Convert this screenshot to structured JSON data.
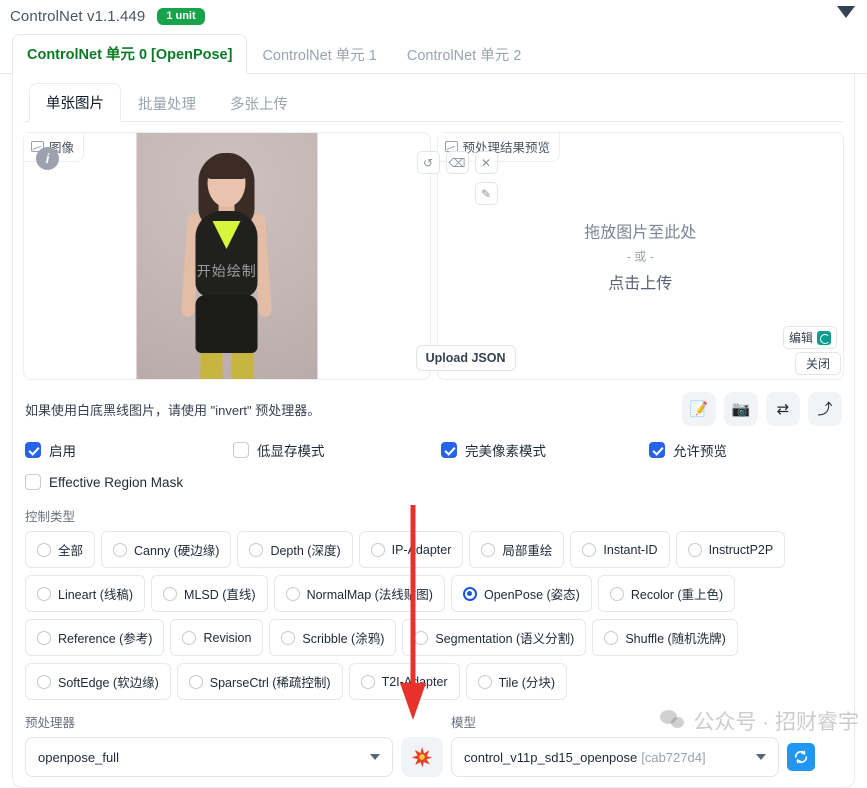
{
  "header": {
    "title": "ControlNet v1.1.449",
    "badge": "1 unit",
    "collapse_icon": "triangle-down-icon"
  },
  "outer_tabs": [
    {
      "label": "ControlNet 单元 0 [OpenPose]",
      "active": true
    },
    {
      "label": "ControlNet 单元 1",
      "active": false
    },
    {
      "label": "ControlNet 单元 2",
      "active": false
    }
  ],
  "inner_tabs": [
    {
      "label": "单张图片",
      "active": true
    },
    {
      "label": "批量处理",
      "active": false
    },
    {
      "label": "多张上传",
      "active": false
    }
  ],
  "image_panel": {
    "label": "图像",
    "info_badge": "i",
    "photo_watermark": "开始绘制",
    "tools": [
      {
        "name": "undo-icon",
        "glyph": "↺"
      },
      {
        "name": "eraser-icon",
        "glyph": "⌫"
      },
      {
        "name": "close-icon",
        "glyph": "✕"
      },
      {
        "name": "pen-icon",
        "glyph": "✎"
      }
    ],
    "upload_json": "Upload JSON"
  },
  "preview_panel": {
    "label": "预处理结果预览",
    "drop_line1": "拖放图片至此处",
    "drop_line2": "- 或 -",
    "drop_line3": "点击上传",
    "edit_button": "编辑",
    "close_button": "关闭"
  },
  "hint": {
    "text": "如果使用白底黑线图片，请使用 \"invert\" 预处理器。",
    "buttons": [
      {
        "name": "edit-note-icon",
        "glyph": "📝"
      },
      {
        "name": "camera-icon",
        "glyph": "📷"
      },
      {
        "name": "swap-icon",
        "glyph": "⇄"
      },
      {
        "name": "send-to-icon",
        "glyph": "⤴"
      }
    ]
  },
  "checkboxes_row1": [
    {
      "label": "启用",
      "checked": true
    },
    {
      "label": "低显存模式",
      "checked": false
    },
    {
      "label": "完美像素模式",
      "checked": true
    },
    {
      "label": "允许预览",
      "checked": true
    }
  ],
  "checkboxes_row2": [
    {
      "label": "Effective Region Mask",
      "checked": false
    }
  ],
  "control_type": {
    "label": "控制类型",
    "rows": [
      [
        {
          "label": "全部",
          "selected": false
        },
        {
          "label": "Canny (硬边缘)",
          "selected": false
        },
        {
          "label": "Depth (深度)",
          "selected": false
        },
        {
          "label": "IP-Adapter",
          "selected": false
        },
        {
          "label": "局部重绘",
          "selected": false
        },
        {
          "label": "Instant-ID",
          "selected": false
        },
        {
          "label": "InstructP2P",
          "selected": false
        }
      ],
      [
        {
          "label": "Lineart (线稿)",
          "selected": false
        },
        {
          "label": "MLSD (直线)",
          "selected": false
        },
        {
          "label": "NormalMap (法线贴图)",
          "selected": false
        },
        {
          "label": "OpenPose (姿态)",
          "selected": true
        },
        {
          "label": "Recolor (重上色)",
          "selected": false
        }
      ],
      [
        {
          "label": "Reference (参考)",
          "selected": false
        },
        {
          "label": "Revision",
          "selected": false
        },
        {
          "label": "Scribble (涂鸦)",
          "selected": false
        },
        {
          "label": "Segmentation (语义分割)",
          "selected": false
        },
        {
          "label": "Shuffle (随机洗牌)",
          "selected": false
        }
      ],
      [
        {
          "label": "SoftEdge (软边缘)",
          "selected": false
        },
        {
          "label": "SparseCtrl (稀疏控制)",
          "selected": false
        },
        {
          "label": "T2I-Adapter",
          "selected": false
        },
        {
          "label": "Tile (分块)",
          "selected": false
        }
      ]
    ]
  },
  "bottom": {
    "preprocessor_label": "预处理器",
    "preprocessor_value": "openpose_full",
    "run_icon": "burst-icon",
    "model_label": "模型",
    "model_value": "control_v11p_sd15_openpose",
    "model_hash": "[cab727d4]",
    "refresh_icon": "refresh-icon"
  },
  "watermark": {
    "text": "公众号 · 招财睿宇",
    "logo": "wechat-icon"
  },
  "colors": {
    "accent_blue": "#2563eb",
    "badge_green": "#16a34a",
    "tab_active_green": "#0b7a27",
    "annotation_red": "#e8312a",
    "refresh_blue": "#2196f3"
  }
}
